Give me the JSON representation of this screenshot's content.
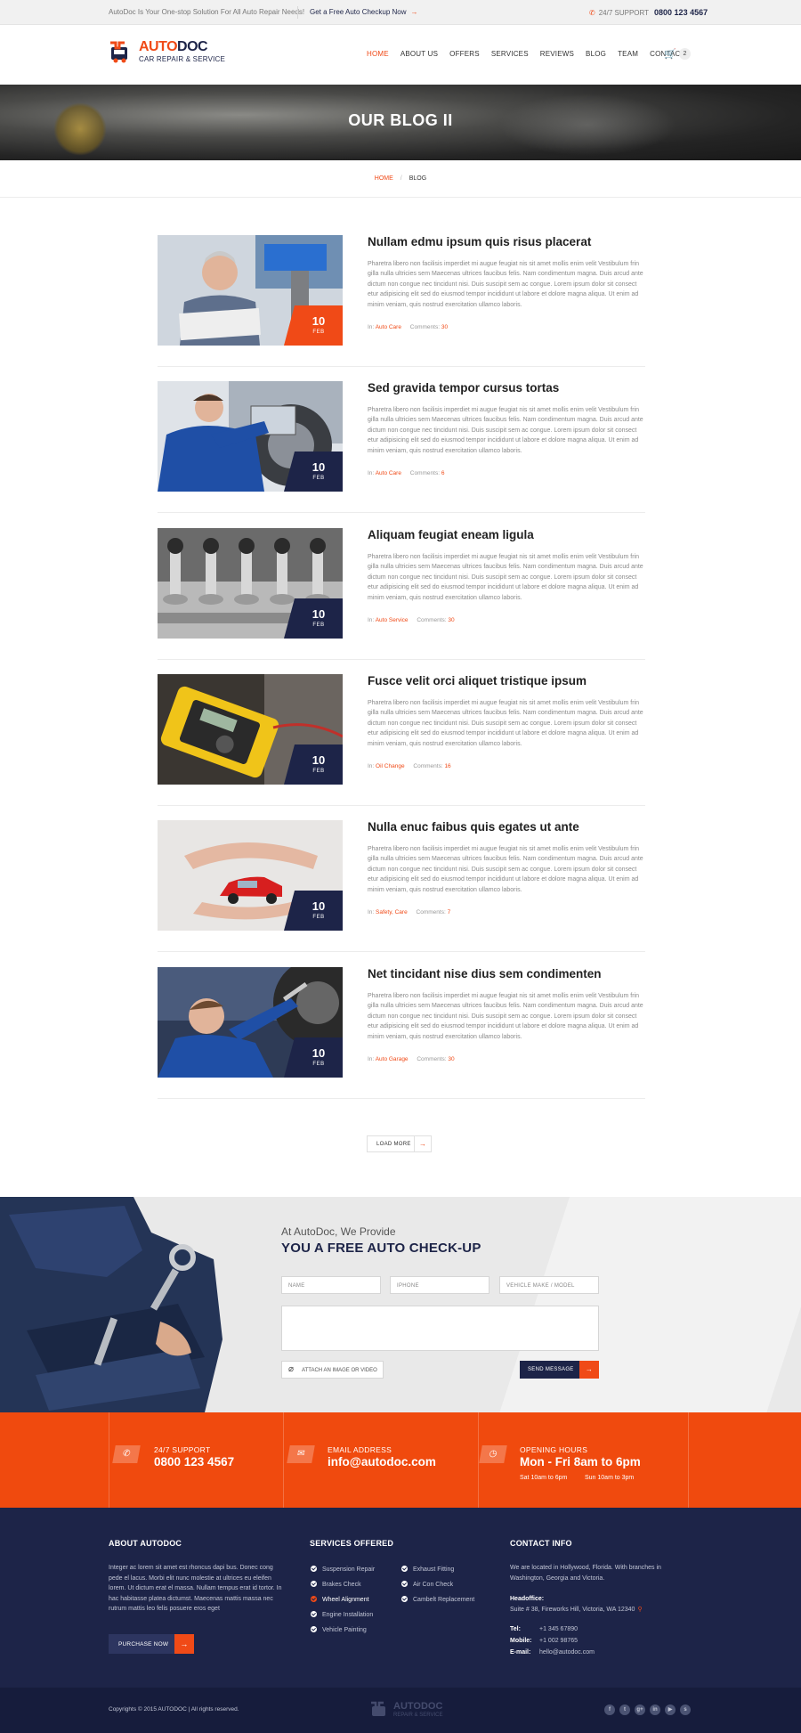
{
  "topbar": {
    "tagline": "AutoDoc Is Your One-stop Solution For All Auto Repair Needs!",
    "checkup_link": "Get a Free Auto Checkup Now",
    "support_label": "24/7 SUPPORT",
    "support_phone": "0800 123 4567"
  },
  "logo": {
    "name_part1": "AUTO",
    "name_part2": "DOC",
    "tagline": "CAR REPAIR & SERVICE"
  },
  "nav": {
    "items": [
      "HOME",
      "ABOUT US",
      "OFFERS",
      "SERVICES",
      "REVIEWS",
      "BLOG",
      "TEAM",
      "CONTACT"
    ],
    "active": "HOME",
    "cart_count": "2"
  },
  "banner": {
    "title": "OUR BLOG II"
  },
  "breadcrumb": {
    "home": "HOME",
    "current": "BLOG"
  },
  "posts": [
    {
      "title": "Nullam edmu ipsum quis risus placerat",
      "day": "10",
      "month": "FEB",
      "category": "Auto Care",
      "comments": "30",
      "image": "mechanic-laptop"
    },
    {
      "title": "Sed gravida tempor cursus tortas",
      "day": "10",
      "month": "FEB",
      "category": "Auto Care",
      "comments": "6",
      "image": "mechanic-wheel-alignment"
    },
    {
      "title": "Aliquam feugiat eneam ligula",
      "day": "10",
      "month": "FEB",
      "category": "Auto Service",
      "comments": "30",
      "image": "engine-valves"
    },
    {
      "title": "Fusce velit orci aliquet tristique ipsum",
      "day": "10",
      "month": "FEB",
      "category": "Oil Change",
      "comments": "16",
      "image": "multimeter"
    },
    {
      "title": "Nulla enuc faibus quis egates ut ante",
      "day": "10",
      "month": "FEB",
      "category": "Safety, Care",
      "comments": "7",
      "image": "hands-red-car"
    },
    {
      "title": "Net tincidant nise dius sem condimenten",
      "day": "10",
      "month": "FEB",
      "category": "Auto Garage",
      "comments": "30",
      "image": "mechanic-under-car"
    }
  ],
  "post_excerpt": "Pharetra libero non facilisis imperdiet mi augue feugiat nis sit amet mollis enim velit  Vestibulum frin gilla nulla ultricies sem Maecenas ultrices faucibus felis. Nam condimentum magna. Duis arcud ante dictum non congue nec tincidunt nisi. Duis suscipit sem ac congue. Lorem ipsum dolor sit consect etur adipisicing elit sed do eiusmod tempor incididunt ut labore et dolore magna aliqua. Ut enim ad minim veniam, quis nostrud exercitation ullamco laboris.",
  "post_meta": {
    "in_label": "In:",
    "comments_label": "Comments:"
  },
  "load_more": "LOAD MORE",
  "checkup": {
    "kicker": "At AutoDoc, We Provide",
    "heading": "YOU A FREE AUTO CHECK-UP",
    "name_placeholder": "NAME",
    "phone_placeholder": "IPHONE",
    "vehicle_placeholder": "VEHICLE MAKE / MODEL",
    "attach_label": "ATTACH AN IMAGE OR VIDEO",
    "send_label": "SEND MESSAGE"
  },
  "info_strip": {
    "support_label": "24/7 SUPPORT",
    "support_value": "0800 123 4567",
    "email_label": "EMAIL ADDRESS",
    "email_value": "info@autodoc.com",
    "hours_label": "OPENING HOURS",
    "hours_value": "Mon - Fri  8am to 6pm",
    "hours_sat": "Sat 10am to 6pm",
    "hours_sun": "Sun 10am to 3pm"
  },
  "footer": {
    "about_heading": "ABOUT AUTODOC",
    "about_text": "Integer ac lorem sit amet est rhoncus dapi bus. Donec cong pede el lacus. Morbi elit nunc molestie at ultrices eu eleifen lorem. Ut dictum erat el massa. Nullam tempus erat id tortor. In hac habitasse platea dictumst. Maecenas mattis massa nec rutrum mattis leo felis posuere eros eget",
    "purchase_label": "PURCHASE NOW",
    "services_heading": "SERVICES OFFERED",
    "services_col1": [
      "Suspension Repair",
      "Brakes Check",
      "Wheel Alignment",
      "Engine Installation",
      "Vehicle Painting"
    ],
    "services_col2": [
      "Exhaust Fitting",
      "Air Con Check",
      "Cambelt Replacement"
    ],
    "services_highlight": "Wheel Alignment",
    "contact_heading": "CONTACT INFO",
    "contact_intro": "We are located in Hollywood, Florida. With branches in Washington, Georgia and Victoria.",
    "headoffice_label": "Headoffice:",
    "headoffice_address": "Suite # 38, Fireworks Hill, Victoria, WA 12340",
    "tel_label": "Tel:",
    "tel": "+1 345 67890",
    "mobile_label": "Mobile:",
    "mobile": "+1 002 98765",
    "email_label": "E-mail:",
    "email": "hello@autodoc.com",
    "copyright": "Copyrights © 2015 AUTODOC | All rights reserved.",
    "bottom_logo_name": "AUTODOC",
    "bottom_logo_sub": "REPAIR & SERVICE",
    "socials": [
      "facebook-icon",
      "twitter-icon",
      "google-plus-icon",
      "linkedin-icon",
      "youtube-icon",
      "skype-icon"
    ]
  },
  "colors": {
    "accent": "#f04a17",
    "navy": "#1d2448"
  }
}
